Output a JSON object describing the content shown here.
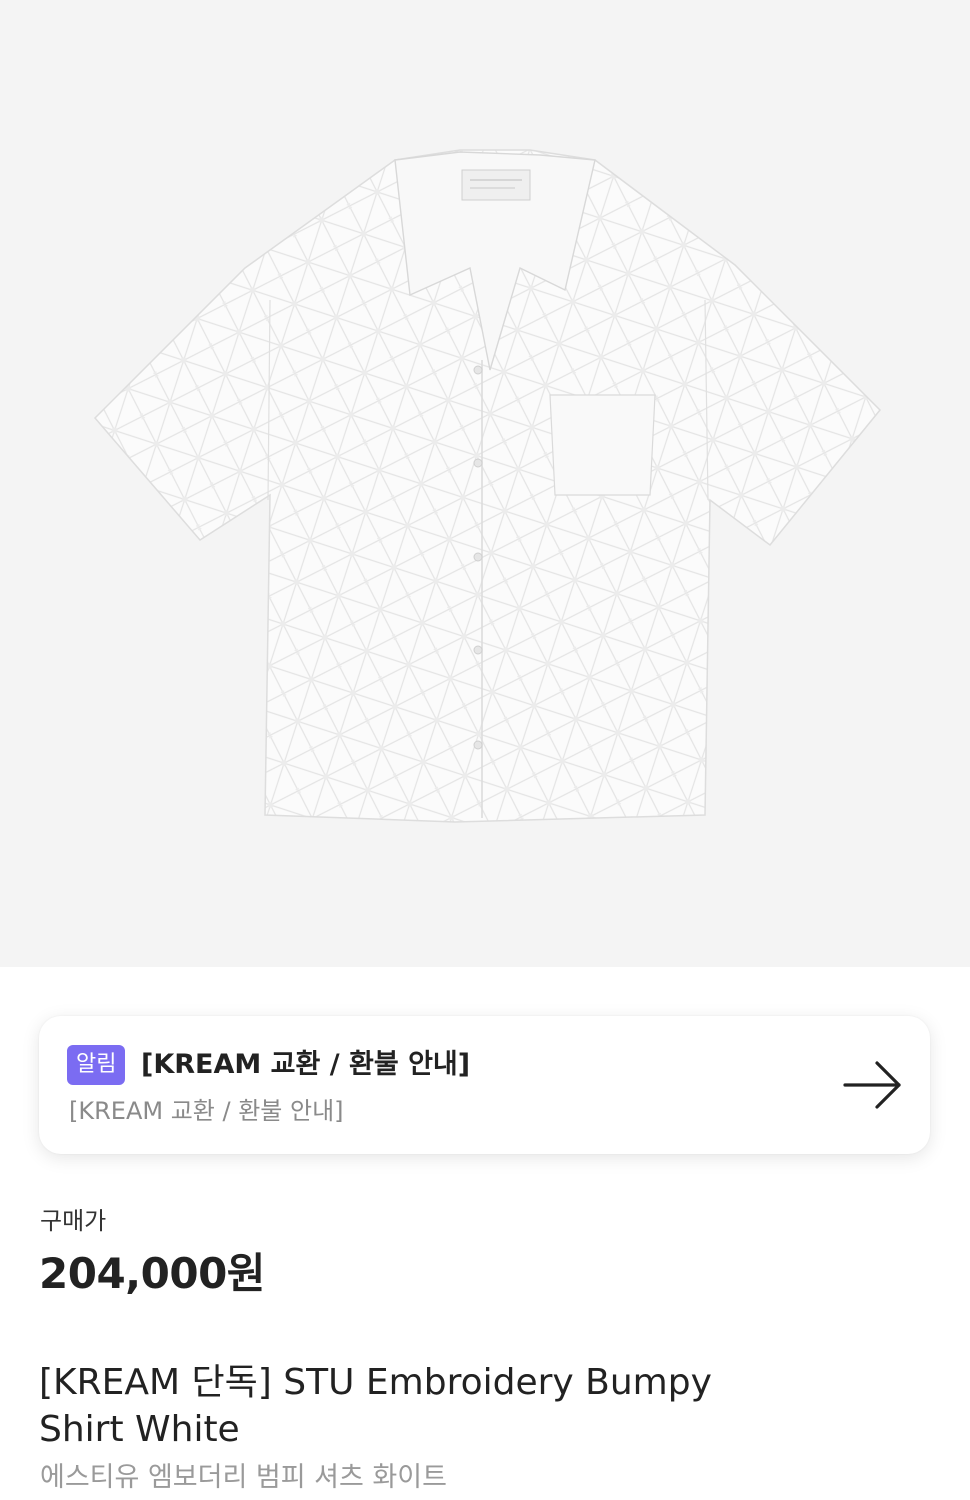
{
  "notice": {
    "badge": "알림",
    "title": "[KREAM 교환 / 환불 안내]",
    "subtitle": "[KREAM 교환 / 환불 안내]"
  },
  "price": {
    "label": "구매가",
    "value": "204,000원"
  },
  "product": {
    "title": "[KREAM 단독] STU Embroidery Bumpy Shirt White",
    "subtitle": "에스티유 엠보더리 범피 셔츠 화이트"
  },
  "colors": {
    "hero_background": "#f4f4f4",
    "badge": "#7b6cf2"
  },
  "icons": {
    "notice_arrow": "arrow-right-icon"
  }
}
